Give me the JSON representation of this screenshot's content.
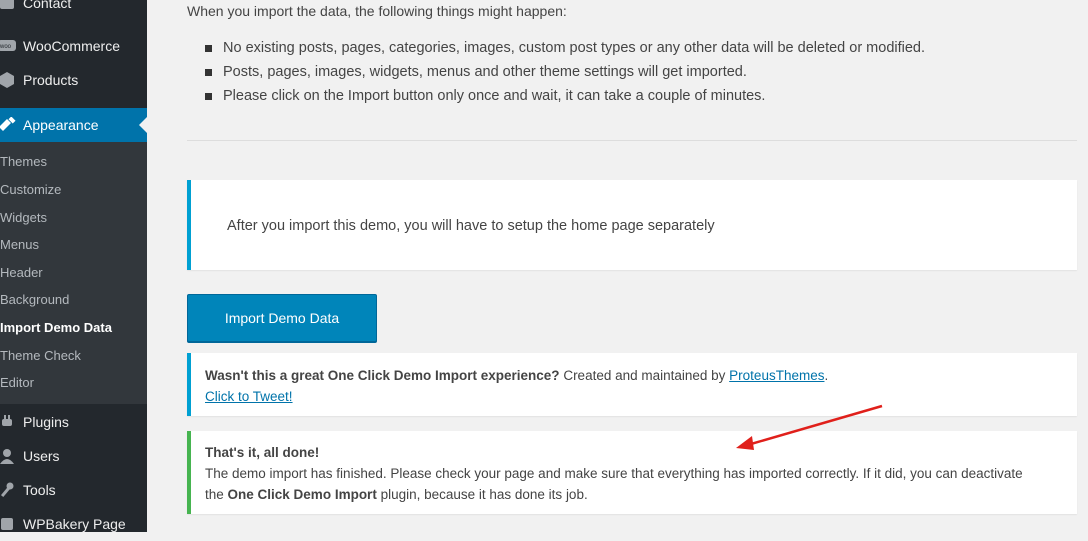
{
  "sidebar": {
    "top_items": [
      {
        "label": "Contact",
        "icon": "contact-icon"
      },
      {
        "label": "WooCommerce",
        "icon": "woocommerce-icon"
      },
      {
        "label": "Products",
        "icon": "products-icon"
      },
      {
        "label": "Appearance",
        "icon": "appearance-icon"
      }
    ],
    "submenu": [
      "Themes",
      "Customize",
      "Widgets",
      "Menus",
      "Header",
      "Background",
      "Import Demo Data",
      "Theme Check",
      "Editor"
    ],
    "bottom_items": [
      {
        "label": "Plugins",
        "icon": "plugins-icon"
      },
      {
        "label": "Users",
        "icon": "users-icon"
      },
      {
        "label": "Tools",
        "icon": "tools-icon"
      },
      {
        "label": "WPBakery Page",
        "icon": "wpbakery-icon"
      }
    ]
  },
  "main": {
    "intro": "When you import the data, the following things might happen:",
    "bullets": [
      "No existing posts, pages, categories, images, custom post types or any other data will be deleted or modified.",
      "Posts, pages, images, widgets, menus and other theme settings will get imported.",
      "Please click on the Import button only once and wait, it can take a couple of minutes."
    ],
    "notice": "After you import this demo, you will have to setup the home page separately",
    "import_button": "Import Demo Data",
    "tweet": {
      "bold": "Wasn't this a great One Click Demo Import experience?",
      "text": " Created and maintained by ",
      "link": "ProteusThemes",
      "period": ".",
      "tweet_link": "Click to Tweet!"
    },
    "done": {
      "title": "That's it, all done!",
      "line2": "The demo import has finished. Please check your page and make sure that everything has imported correctly. If it did, you can deactivate",
      "line3_pre": "the ",
      "line3_bold": "One Click Demo Import",
      "line3_post": " plugin, because it has done its job."
    }
  },
  "colors": {
    "sidebar_bg": "#23282d",
    "submenu_bg": "#32373c",
    "active_blue": "#0073aa",
    "button_blue": "#0085ba",
    "info_border": "#00a0d2",
    "success_border": "#46b450",
    "annotation_arrow": "#e0201b"
  }
}
